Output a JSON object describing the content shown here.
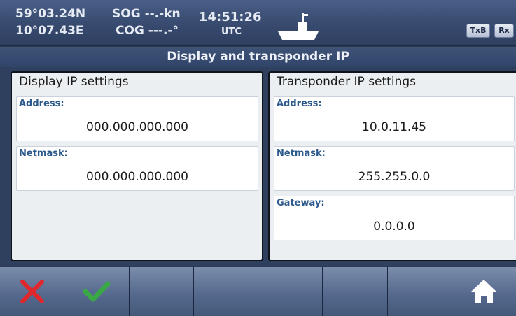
{
  "status": {
    "latitude": "59°03.24N",
    "longitude": "10°07.43E",
    "sog": "SOG --.-kn",
    "cog": "COG ---.-°",
    "time": "14:51:26",
    "timezone": "UTC",
    "vessel_icon": "ship-icon",
    "txb_label": "TxB",
    "rx_label": "Rx"
  },
  "title": "Display and transponder IP",
  "display_panel": {
    "heading": "Display IP settings",
    "address_label": "Address:",
    "address_value": "000.000.000.000",
    "netmask_label": "Netmask:",
    "netmask_value": "000.000.000.000"
  },
  "transponder_panel": {
    "heading": "Transponder IP settings",
    "address_label": "Address:",
    "address_value": "10.0.11.45",
    "netmask_label": "Netmask:",
    "netmask_value": "255.255.0.0",
    "gateway_label": "Gateway:",
    "gateway_value": "0.0.0.0"
  },
  "buttons": {
    "cancel_icon": "close-icon",
    "confirm_icon": "checkmark-icon",
    "home_icon": "home-icon"
  },
  "colors": {
    "cancel": "#e0272b",
    "confirm": "#3aa845",
    "field_label": "#2d5a8c"
  }
}
